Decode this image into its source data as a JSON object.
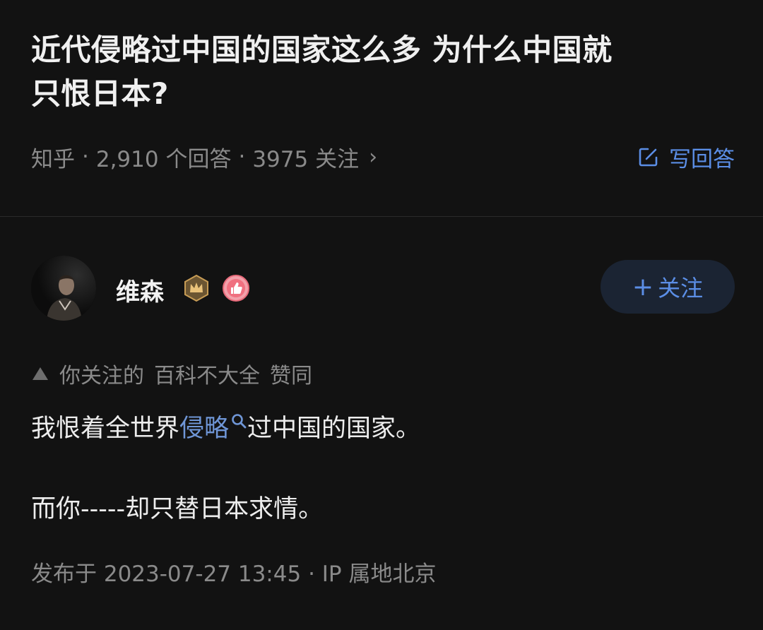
{
  "question": {
    "title_line1": "近代侵略过中国的国家这么多 为什么中国就",
    "title_line2": "只恨日本?",
    "source": "知乎",
    "answers": "2,910 个回答",
    "followers": "3975 关注",
    "write_answer_label": "写回答"
  },
  "author": {
    "name": "维森",
    "follow_label": "关注",
    "follow_plus": "+"
  },
  "vote_info": {
    "prefix": "你关注的",
    "user": "百科不大全",
    "action": "赞同"
  },
  "answer": {
    "p1_before": "我恨着全世界",
    "p1_keyword": "侵略",
    "p1_after": "过中国的国家。",
    "p2": "而你-----却只替日本求情。"
  },
  "footer": {
    "publish": "发布于 2023-07-27 13:45",
    "ip": "IP 属地北京"
  },
  "colors": {
    "background": "#121212",
    "accent": "#5b8ee6",
    "muted": "#8a8a8a",
    "follow_bg": "#1b2433"
  },
  "icons": {
    "edit": "edit-icon",
    "search": "search-icon",
    "crown": "crown-badge-icon",
    "thumb": "thumbs-up-badge-icon"
  }
}
